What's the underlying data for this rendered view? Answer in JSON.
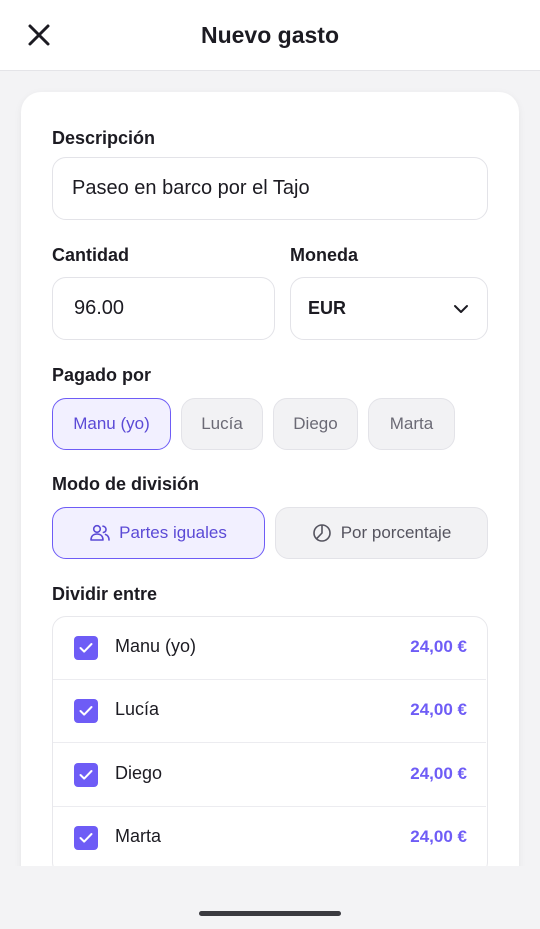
{
  "header": {
    "title": "Nuevo gasto",
    "close_icon": "close-icon"
  },
  "form": {
    "description": {
      "label": "Descripción",
      "value": "Paseo en barco por el Tajo"
    },
    "amount": {
      "label": "Cantidad",
      "value": "96.00"
    },
    "currency": {
      "label": "Moneda",
      "value": "EUR",
      "icon": "chevron-down-icon"
    },
    "paid_by": {
      "label": "Pagado por",
      "options": [
        "Manu (yo)",
        "Lucía",
        "Diego",
        "Marta"
      ],
      "selected": "Manu (yo)"
    },
    "split_mode": {
      "label": "Modo de división",
      "options": [
        {
          "label": "Partes iguales",
          "icon": "users-icon",
          "selected": true
        },
        {
          "label": "Por porcentaje",
          "icon": "pie-chart-icon",
          "selected": false
        }
      ]
    },
    "split_between": {
      "label": "Dividir entre",
      "members": [
        {
          "name": "Manu (yo)",
          "amount": "24,00 €",
          "checked": true
        },
        {
          "name": "Lucía",
          "amount": "24,00 €",
          "checked": true
        },
        {
          "name": "Diego",
          "amount": "24,00 €",
          "checked": true
        },
        {
          "name": "Marta",
          "amount": "24,00 €",
          "checked": true
        }
      ]
    }
  },
  "colors": {
    "accent": "#6e5cf6",
    "accent_bg": "#f2f0ff",
    "text": "#1c1b22",
    "muted": "#6b6a75"
  }
}
